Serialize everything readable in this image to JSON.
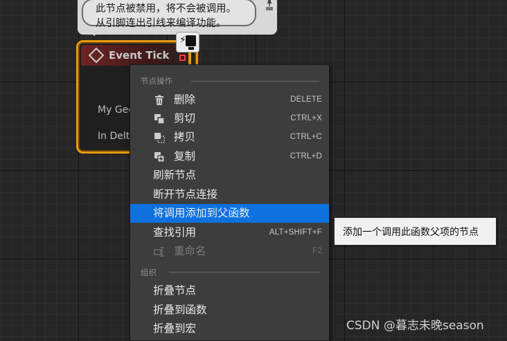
{
  "disabled_bubble": {
    "line1": "此节点被禁用，将不会被调用。",
    "line2": "从引脚连出引线来编译功能。"
  },
  "node": {
    "title": "Event Tick",
    "row1": "My Geo",
    "row2": "In Delt"
  },
  "menu": {
    "section_node_actions": "节点操作",
    "section_organize": "组织",
    "items": [
      {
        "label": "删除",
        "shortcut": "DELETE",
        "icon": "trash-icon"
      },
      {
        "label": "剪切",
        "shortcut": "CTRL+X",
        "icon": "cut-icon"
      },
      {
        "label": "拷贝",
        "shortcut": "CTRL+C",
        "icon": "copy-icon"
      },
      {
        "label": "复制",
        "shortcut": "CTRL+D",
        "icon": "duplicate-icon"
      },
      {
        "label": "刷新节点",
        "shortcut": ""
      },
      {
        "label": "断开节点连接",
        "shortcut": ""
      },
      {
        "label": "将调用添加到父函数",
        "shortcut": "",
        "highlighted": true
      },
      {
        "label": "查找引用",
        "shortcut": "ALT+SHIFT+F"
      },
      {
        "label": "重命名",
        "shortcut": "F2",
        "icon": "rename-icon",
        "disabled": true
      },
      {
        "label": "折叠节点",
        "shortcut": ""
      },
      {
        "label": "折叠到函数",
        "shortcut": ""
      },
      {
        "label": "折叠到宏",
        "shortcut": ""
      }
    ]
  },
  "tooltip": {
    "text": "添加一个调用此函数父项的节点"
  },
  "watermark": "CSDN @暮志未晚season",
  "colors": {
    "highlight": "#0d72e0",
    "node_border": "#e89a0c",
    "exec_pin": "#ff3b3b"
  }
}
